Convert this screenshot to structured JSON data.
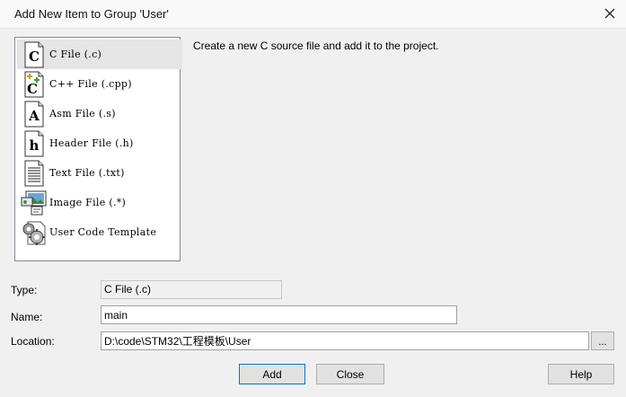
{
  "dialog": {
    "title": "Add New Item to Group 'User'"
  },
  "file_types": [
    {
      "label": "C File (.c)",
      "icon": "c-file-icon",
      "selected": true
    },
    {
      "label": "C++ File (.cpp)",
      "icon": "cpp-file-icon",
      "selected": false
    },
    {
      "label": "Asm File (.s)",
      "icon": "asm-file-icon",
      "selected": false
    },
    {
      "label": "Header File (.h)",
      "icon": "header-file-icon",
      "selected": false
    },
    {
      "label": "Text File (.txt)",
      "icon": "text-file-icon",
      "selected": false
    },
    {
      "label": "Image File (.*)",
      "icon": "image-file-icon",
      "selected": false
    },
    {
      "label": "User Code Template",
      "icon": "code-template-icon",
      "selected": false
    }
  ],
  "description": "Create a new C source file and add it to the project.",
  "form": {
    "type_label": "Type:",
    "type_value": "C File (.c)",
    "name_label": "Name:",
    "name_value": "main",
    "location_label": "Location:",
    "location_value": "D:\\code\\STM32\\工程模板\\User",
    "browse_label": "..."
  },
  "buttons": {
    "add": "Add",
    "close": "Close",
    "help": "Help"
  },
  "colors": {
    "selection": "#e5e5e5",
    "default_button_border": "#0078d7",
    "dialog_bg": "#f0f0f0"
  }
}
